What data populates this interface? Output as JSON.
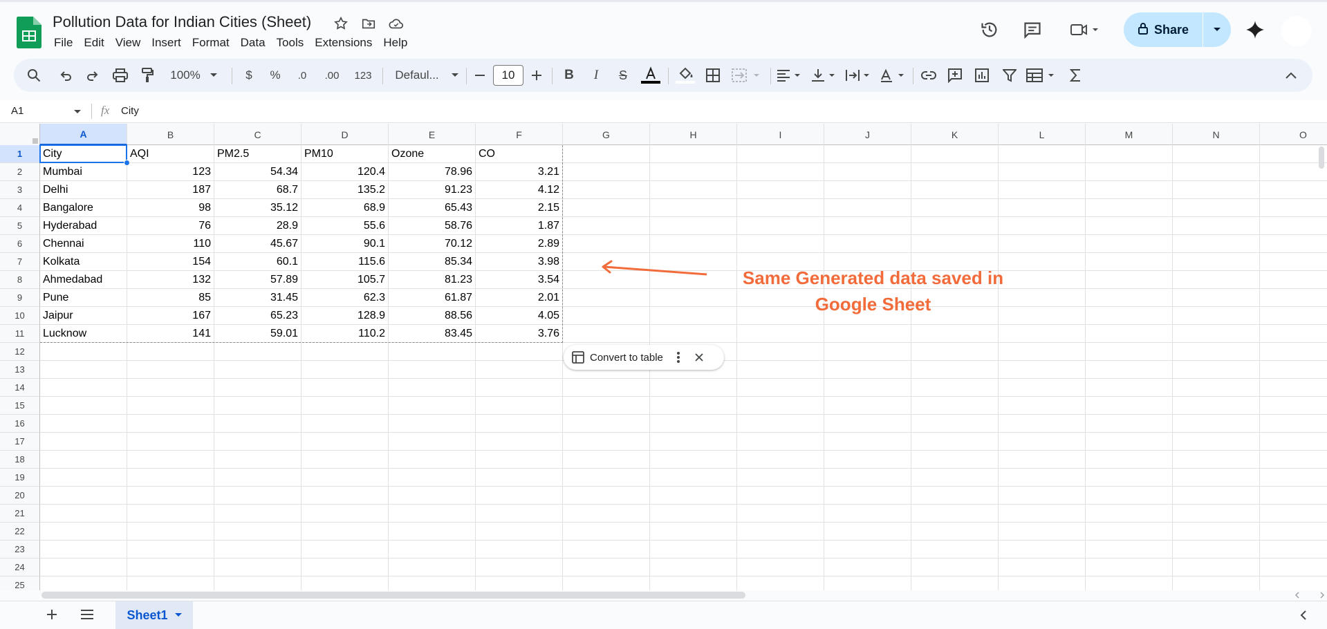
{
  "app": {
    "title": "Pollution Data for Indian Cities (Sheet)",
    "accent": "#0f9d58"
  },
  "menu": [
    "File",
    "Edit",
    "View",
    "Insert",
    "Format",
    "Data",
    "Tools",
    "Extensions",
    "Help"
  ],
  "header": {
    "share_label": "Share"
  },
  "toolbar": {
    "zoom": "100%",
    "currency": "$",
    "percent": "%",
    "decrease_decimal": ".0",
    "increase_decimal": ".00",
    "number_format": "123",
    "font": "Defaul...",
    "font_size": "10"
  },
  "formula_bar": {
    "cell_ref": "A1",
    "fx": "fx",
    "content": "City"
  },
  "columns": [
    "A",
    "B",
    "C",
    "D",
    "E",
    "F",
    "G",
    "H",
    "I",
    "J",
    "K",
    "L",
    "M",
    "N",
    "O"
  ],
  "rows": [
    "1",
    "2",
    "3",
    "4",
    "5",
    "6",
    "7",
    "8",
    "9",
    "10",
    "11",
    "12",
    "13",
    "14",
    "15",
    "16",
    "17",
    "18",
    "19",
    "20",
    "21",
    "22",
    "23",
    "24",
    "25"
  ],
  "table": {
    "headers": [
      "City",
      "AQI",
      "PM2.5",
      "PM10",
      "Ozone",
      "CO"
    ],
    "rows": [
      [
        "Mumbai",
        "123",
        "54.34",
        "120.4",
        "78.96",
        "3.21"
      ],
      [
        "Delhi",
        "187",
        "68.7",
        "135.2",
        "91.23",
        "4.12"
      ],
      [
        "Bangalore",
        "98",
        "35.12",
        "68.9",
        "65.43",
        "2.15"
      ],
      [
        "Hyderabad",
        "76",
        "28.9",
        "55.6",
        "58.76",
        "1.87"
      ],
      [
        "Chennai",
        "110",
        "45.67",
        "90.1",
        "70.12",
        "2.89"
      ],
      [
        "Kolkata",
        "154",
        "60.1",
        "115.6",
        "85.34",
        "3.98"
      ],
      [
        "Ahmedabad",
        "132",
        "57.89",
        "105.7",
        "81.23",
        "3.54"
      ],
      [
        "Pune",
        "85",
        "31.45",
        "62.3",
        "61.87",
        "2.01"
      ],
      [
        "Jaipur",
        "167",
        "65.23",
        "128.9",
        "88.56",
        "4.05"
      ],
      [
        "Lucknow",
        "141",
        "59.01",
        "110.2",
        "83.45",
        "3.76"
      ]
    ]
  },
  "chip": {
    "label": "Convert to table"
  },
  "annotation": {
    "line1": "Same Generated data saved in",
    "line2": "Google Sheet",
    "color": "#f26b3a"
  },
  "sheets": {
    "active": "Sheet1"
  }
}
